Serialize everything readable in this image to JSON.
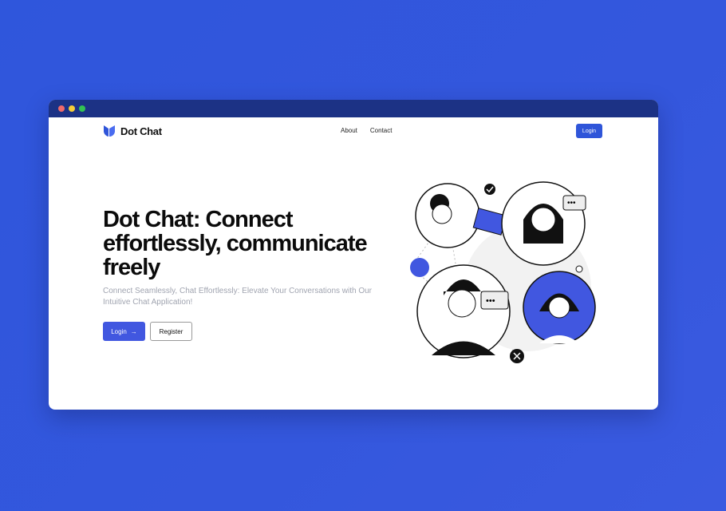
{
  "nav": {
    "brand": "Dot Chat",
    "links": [
      "About",
      "Contact"
    ],
    "login": "Login"
  },
  "hero": {
    "title": "Dot Chat: Connect effortlessly, communicate freely",
    "subtitle": "Connect Seamlessly, Chat Effortlessly: Elevate Your Conversations with Our Intuitive Chat Application!",
    "login": "Login",
    "register": "Register"
  },
  "colors": {
    "accent": "#2f55d9",
    "titlebar": "#1c3285"
  }
}
